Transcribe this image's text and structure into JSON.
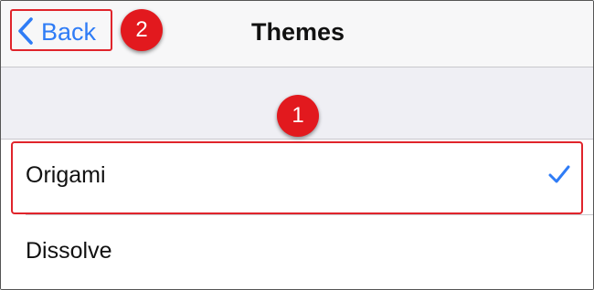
{
  "nav": {
    "back_label": "Back",
    "title": "Themes"
  },
  "annotations": [
    {
      "number": "1",
      "color": "#e2191e"
    },
    {
      "number": "2",
      "color": "#e2191e"
    }
  ],
  "themes": {
    "items": [
      {
        "label": "Origami",
        "selected": true
      },
      {
        "label": "Dissolve",
        "selected": false
      }
    ]
  },
  "colors": {
    "accent": "#2f7cf6",
    "annotation_red": "#e0242b",
    "grouped_background": "#efeff4"
  }
}
